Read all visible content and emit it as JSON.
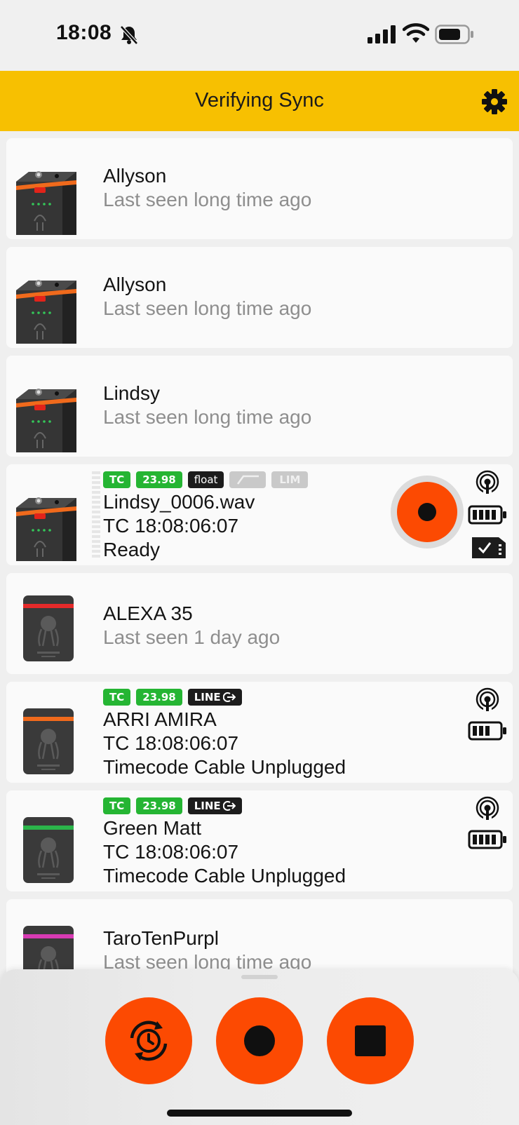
{
  "status_bar": {
    "time": "18:08",
    "icons": [
      "bell-muted-icon",
      "cellular-signal-icon",
      "wifi-icon",
      "battery-icon"
    ]
  },
  "header": {
    "title": "Verifying Sync",
    "icons": [
      "gear-icon"
    ],
    "background": "#f7c001"
  },
  "devices": [
    {
      "name": "Allyson",
      "status": "Last seen long time ago",
      "type": "track-e",
      "accent": "#f06a1c"
    },
    {
      "name": "Allyson",
      "status": "Last seen long time ago",
      "type": "track-e",
      "accent": "#f06a1c"
    },
    {
      "name": "Lindsy",
      "status": "Last seen long time ago",
      "type": "track-e",
      "accent": "#f06a1c"
    },
    {
      "badges": [
        "TC",
        "23.98",
        "float",
        "LIM"
      ],
      "filename": "Lindsy_0006.wav",
      "timecode": "TC 18:08:06:07",
      "status": "Ready",
      "type": "track-e",
      "accent": "#f06a1c"
    },
    {
      "name": "ALEXA 35",
      "status": "Last seen 1 day ago",
      "type": "sync-e",
      "accent": "#e52a2a"
    },
    {
      "badges": [
        "TC",
        "23.98",
        "LINE"
      ],
      "name": "ARRI AMIRA",
      "timecode": "TC 18:08:06:07",
      "status": "Timecode Cable Unplugged",
      "type": "sync-e",
      "accent": "#f06a1c"
    },
    {
      "badges": [
        "TC",
        "23.98",
        "LINE"
      ],
      "name": "Green Matt",
      "timecode": "TC 18:08:06:07",
      "status": "Timecode Cable Unplugged",
      "type": "sync-e",
      "accent": "#2bb54a"
    },
    {
      "name": "TaroTenPurpl",
      "status": "Last seen long time ago",
      "type": "sync-e",
      "accent": "#d83bb4"
    }
  ],
  "bottom_controls": {
    "buttons": [
      "sync-clock-icon",
      "record-icon",
      "stop-icon"
    ],
    "accent": "#fc4a02"
  },
  "colors": {
    "badge_green": "#25b533",
    "record_orange": "#fc4a02"
  }
}
